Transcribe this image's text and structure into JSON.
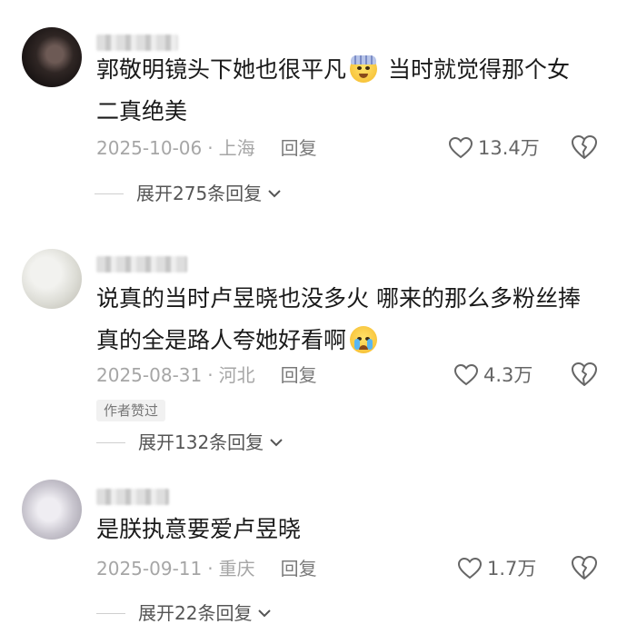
{
  "comments": [
    {
      "text_before": "郭敬明镜头下她也很平凡",
      "emoji": "exploding-head-bandage-emoji",
      "text_after": " 当时就觉得那个女",
      "text_line2": "二真绝美",
      "date": "2025-10-06",
      "separator": "·",
      "location": "上海",
      "reply_label": "回复",
      "likes": "13.4万",
      "expand_label": "展开275条回复"
    },
    {
      "text_before": "说真的当时卢昱晓也没多火 哪来的那么多粉丝捧",
      "text_line2": "真的全是路人夸她好看啊",
      "emoji": "crying-face-emoji",
      "date": "2025-08-31",
      "separator": "·",
      "location": "河北",
      "reply_label": "回复",
      "likes": "4.3万",
      "badge": "作者赞过",
      "expand_label": "展开132条回复"
    },
    {
      "text_before": "是朕执意要爱卢昱晓",
      "date": "2025-09-11",
      "separator": "·",
      "location": "重庆",
      "reply_label": "回复",
      "likes": "1.7万",
      "expand_label": "展开22条回复"
    }
  ],
  "colors": {
    "text": "#1a1a1a",
    "meta": "#a6a6a6",
    "icon": "#666666"
  }
}
